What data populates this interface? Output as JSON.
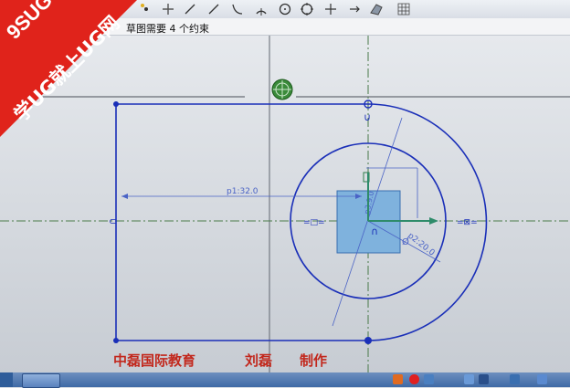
{
  "status": {
    "message": "草图需要 4 个约束"
  },
  "toolbar": {
    "icons": [
      "point-icon",
      "line-icon",
      "arc-icon",
      "circle-icon",
      "fillet-icon",
      "crosshair-icon",
      "trim-icon",
      "extend-icon",
      "grid-icon"
    ]
  },
  "watermark": {
    "line1": "9SUG",
    "line2": "学UG就上UG网"
  },
  "sketch": {
    "dimensions": {
      "p1": "p1:32.0",
      "p2": "p2:20.0",
      "p3": "p3:9.0",
      "diameter_symbol": "Ø"
    },
    "colors": {
      "geometry": "#1a2fb8",
      "dimension": "#4a63c6",
      "axis": "#4a7a4a",
      "square_fill": "#7fb2dd",
      "accent_red": "#c2281d"
    }
  },
  "credits": {
    "org": "中磊国际教育",
    "author": "刘磊",
    "made": "制作"
  }
}
